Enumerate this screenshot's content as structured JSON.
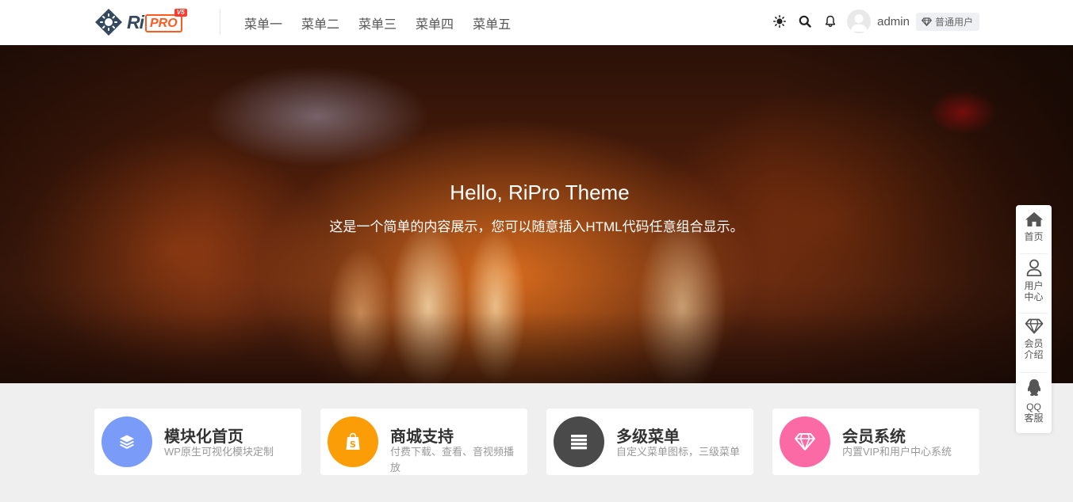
{
  "brand": {
    "logo_ri": "Ri",
    "logo_pro": "PRO",
    "logo_version": "V5"
  },
  "nav": {
    "items": [
      {
        "label": "菜单一"
      },
      {
        "label": "菜单二"
      },
      {
        "label": "菜单三"
      },
      {
        "label": "菜单四"
      },
      {
        "label": "菜单五"
      }
    ]
  },
  "user": {
    "name": "admin",
    "badge_icon": "diamond-icon",
    "badge": "普通用户"
  },
  "hero": {
    "title": "Hello, RiPro Theme",
    "subtitle": "这是一个简单的内容展示，您可以随意插入HTML代码任意组合显示。"
  },
  "features": [
    {
      "title": "模块化首页",
      "desc": "WP原生可视化模块定制",
      "icon": "layers-icon",
      "color": "#7a9cf8"
    },
    {
      "title": "商城支持",
      "desc": "付费下载、查看、音视频播放",
      "icon": "shopify-icon",
      "color": "#fb9d07"
    },
    {
      "title": "多级菜单",
      "desc": "自定义菜单图标，三级菜单",
      "icon": "list-icon",
      "color": "#4a4a4a"
    },
    {
      "title": "会员系统",
      "desc": "内置VIP和用户中心系统",
      "icon": "diamond-icon",
      "color": "#fc6aa5"
    }
  ],
  "floatbar": {
    "items": [
      {
        "label": "首页",
        "icon": "home-icon"
      },
      {
        "label": "用户中心",
        "icon": "user-icon"
      },
      {
        "label": "会员介绍",
        "icon": "diamond-icon"
      },
      {
        "label": "QQ客服",
        "icon": "qq-icon"
      }
    ]
  },
  "colors": {
    "brand_orange": "#ff5a1f",
    "logo_dark": "#34495e",
    "page_bg": "#efefef"
  }
}
